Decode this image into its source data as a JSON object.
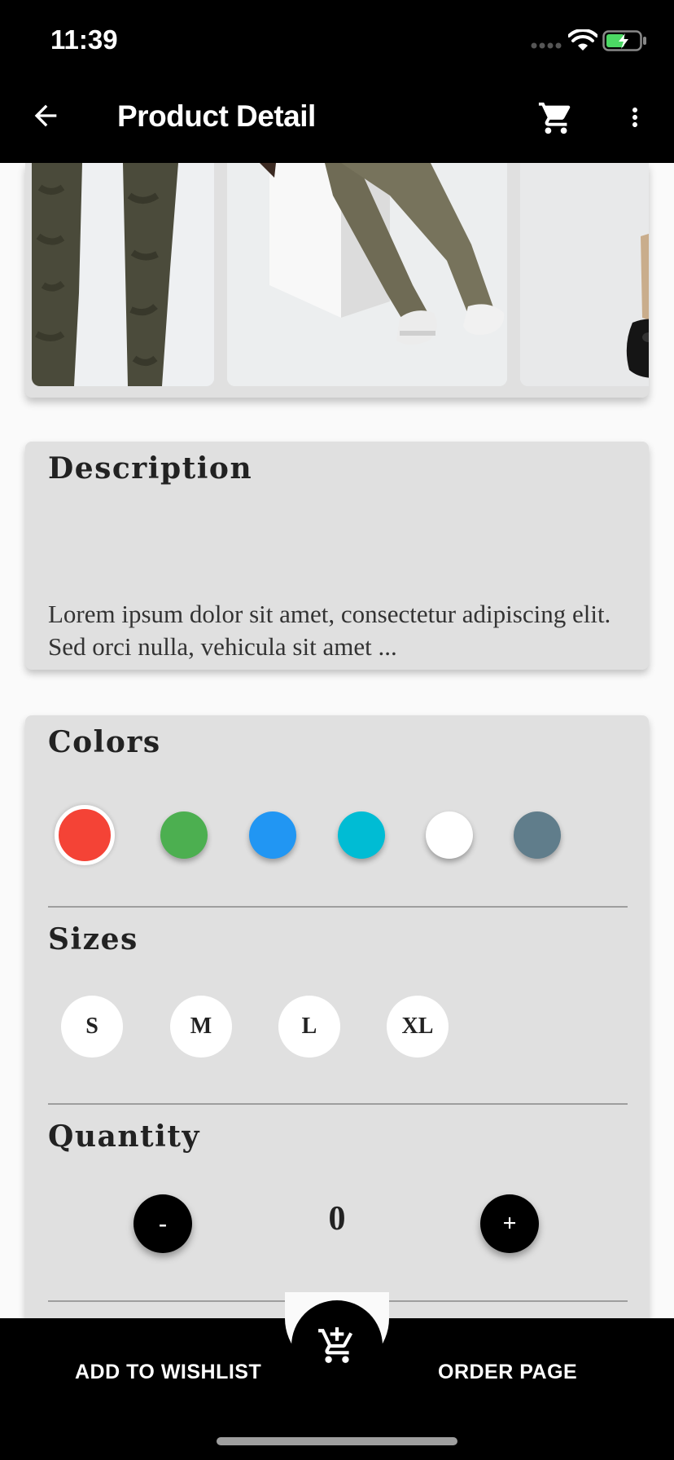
{
  "status_bar": {
    "time": "11:39"
  },
  "app_bar": {
    "title": "Product Detail"
  },
  "gallery": {
    "images": [
      {
        "name": "camo-pants-image"
      },
      {
        "name": "olive-pants-image"
      },
      {
        "name": "khaki-pants-image"
      }
    ]
  },
  "description": {
    "title": "Description",
    "text": "Lorem ipsum dolor sit amet, consectetur adipiscing elit. Sed orci nulla, vehicula sit amet ..."
  },
  "colors": {
    "title": "Colors",
    "options": [
      "#f44336",
      "#4caf50",
      "#2196f3",
      "#00bcd4",
      "#ffffff",
      "#607d8b"
    ],
    "selected_index": 0
  },
  "sizes": {
    "title": "Sizes",
    "options": [
      "S",
      "M",
      "L",
      "XL"
    ]
  },
  "quantity": {
    "title": "Quantity",
    "decrement_label": "-",
    "value": "0",
    "increment_label": "+"
  },
  "bottom_bar": {
    "wishlist_label": "ADD TO WISHLIST",
    "order_label": "ORDER PAGE"
  }
}
